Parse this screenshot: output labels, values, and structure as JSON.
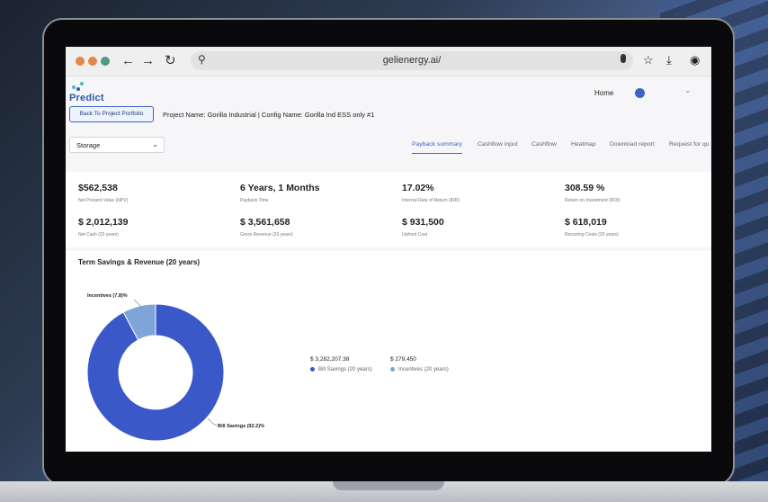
{
  "browser": {
    "url": "gelienergy.ai/",
    "back_icon": "←",
    "forward_icon": "→",
    "reload_icon": "↻",
    "search_icon": "⚲",
    "star_icon": "☆",
    "download_icon": "⤓",
    "account_icon": "◉"
  },
  "app": {
    "brand": "Predict",
    "nav": {
      "home": "Home"
    },
    "back_button": "Back To Project Portfolio",
    "project_line": "Project Name: Gorilla Industrial | Config Name: Gorilla Ind ESS only #1",
    "select": {
      "value": "Storage"
    },
    "tabs": [
      {
        "label": "Payback summary",
        "active": true
      },
      {
        "label": "Cashflow input",
        "active": false
      },
      {
        "label": "Cashflow",
        "active": false
      },
      {
        "label": "Heatmap",
        "active": false
      },
      {
        "label": "Download report",
        "active": false
      },
      {
        "label": "Request for qu",
        "active": false
      }
    ],
    "kpis": [
      {
        "value": "$562,538",
        "label": "Net Present Value (NPV)"
      },
      {
        "value": "6 Years, 1 Months",
        "label": "Payback Time"
      },
      {
        "value": "17.02%",
        "label": "Internal Rate of Return (IRR)"
      },
      {
        "value": "308.59 %",
        "label": "Return on Investment (ROI)"
      },
      {
        "value": "$ 2,012,139",
        "label": "Net Cash (20 years)"
      },
      {
        "value": "$ 3,561,658",
        "label": "Gross Revenue (20 years)"
      },
      {
        "value": "$ 931,500",
        "label": "Upfront Cost"
      },
      {
        "value": "$ 618,019",
        "label": "Recurring Costs (20 years)"
      }
    ]
  },
  "chart_data": {
    "type": "pie",
    "title": "Term Savings & Revenue (20 years)",
    "categories": [
      "Bill Savings (20 years)",
      "Incentives (20 years)"
    ],
    "values": [
      3282207.38,
      279450
    ],
    "value_labels": [
      "$ 3,282,207.38",
      "$ 279,450"
    ],
    "slice_labels": [
      "Bill Savings (92.2)%",
      "Incentives (7.8)%"
    ],
    "colors": [
      "#3a58c8",
      "#7fa5d8"
    ],
    "donut": true
  }
}
